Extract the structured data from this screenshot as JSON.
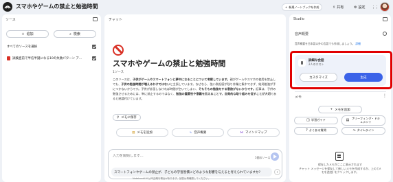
{
  "header": {
    "title": "スマホやゲームの禁止と勉強時間",
    "create_label": "新規ノートブックを作成",
    "share_label": "共有",
    "settings_label": "設定"
  },
  "sources": {
    "heading": "ソース",
    "add_label": "追加",
    "explore_label": "検索",
    "select_all_label": "すべてのソースを選択",
    "items": [
      {
        "label": "試験直前で半信半疑になる10の失敗パターン  ア..."
      }
    ]
  },
  "chat": {
    "heading": "チャット",
    "notebook_title": "スマホやゲームの禁止と勉強時間",
    "source_count": "1ソース",
    "summary_plain_1": "このソースは、",
    "summary_bold_1": "子供がゲームやスマートフォンに夢中になることについて考察しています。",
    "summary_plain_2": "親がゲームやスマホの使用を禁止しても、",
    "summary_bold_2": "子供の勉強時間が増えるわけではない",
    "summary_plain_3": "と主張しています。なぜなら、強い負担感が残り作業に集中できず、結局勉強が手につかないからです。子供が計画しなければ時間が空いてしまい、",
    "summary_bold_3": "そもそもの勉強をする意欲がないからです。",
    "summary_plain_4": "記事は、子供の勉強させるためには、単に禁止するのではなく、",
    "summary_bold_4": "勉強の重要性や意義を伝えることで、自発的な取り組みを促すことが大切",
    "summary_plain_5": "であると結論付けています。",
    "save_memo_label": "メモに保存",
    "chips": [
      {
        "label": "メモを追加",
        "icon": "note-add-icon"
      },
      {
        "label": "音声概要",
        "icon": "waveform-icon"
      },
      {
        "label": "マインドマップ",
        "icon": "mind-map-icon"
      }
    ],
    "input_placeholder": "入力を開始します...",
    "input_source_count": "1個のソース",
    "suggestion": "スマートフォンやゲームの禁止が、子どもの学習習慣にどのような影響を与えると考えられていますか?",
    "footer_note": "NotebookLM は不正確な場合があります。回答は再確認してください。"
  },
  "studio": {
    "heading": "Studio",
    "audio_section": "音声概要",
    "audio_notice": "音声概要を日本語以外の言語でも作成しましょう。",
    "audio_notice_link": "詳細",
    "audio_title": "詳細な会話",
    "audio_sub": "2人のホスト",
    "customize_label": "カスタマイズ",
    "generate_label": "生成",
    "memo_section": "メモ",
    "add_memo_label": "メモを追加",
    "memo_chips": [
      {
        "label": "学習ガイド",
        "icon": "study-guide-icon"
      },
      {
        "label": "ブリーフィング・ドキュメント",
        "icon": "briefing-doc-icon"
      },
      {
        "label": "よくある質問",
        "icon": "faq-icon"
      },
      {
        "label": "タイムライン",
        "icon": "timeline-icon"
      }
    ],
    "empty_message": "保存したメモがここに表示されます\nチャット メッセージを保存して新しいメモを作成するか、上の [メモを追加] をクリックします。"
  },
  "colors": {
    "accent": "#3b63e8",
    "highlight": "#e10000",
    "forbidden": "#d93025"
  }
}
